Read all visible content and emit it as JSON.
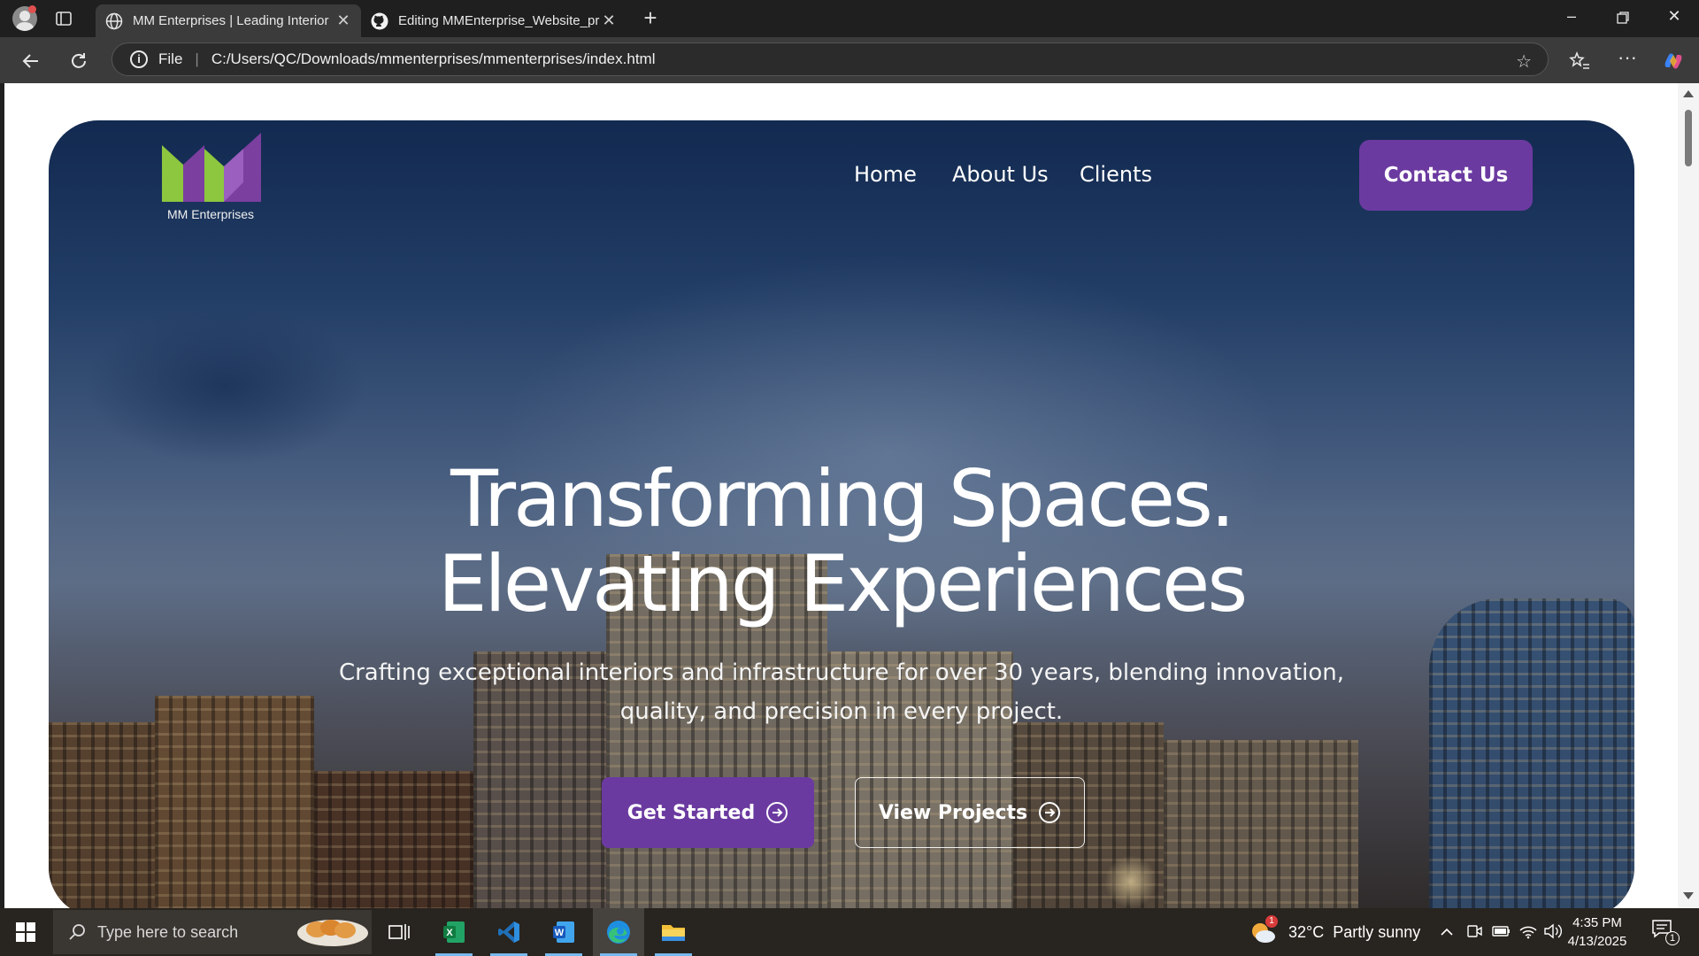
{
  "browser": {
    "tabs": [
      {
        "title": "MM Enterprises | Leading Interior",
        "active": true,
        "icon": "globe-icon"
      },
      {
        "title": "Editing MMEnterprise_Website_pr",
        "active": false,
        "icon": "github-icon"
      }
    ],
    "address": {
      "scheme_label": "File",
      "url": "C:/Users/QC/Downloads/mmenterprises/mmenterprises/index.html"
    }
  },
  "site": {
    "logo_text": "MM Enterprises",
    "nav": [
      {
        "label": "Home"
      },
      {
        "label": "About Us"
      },
      {
        "label": "Clients"
      }
    ],
    "contact_label": "Contact Us",
    "headline_line1": "Transforming Spaces.",
    "headline_line2": "Elevating Experiences",
    "subtitle": "Crafting exceptional interiors and infrastructure for over 30 years, blending innovation, quality, and precision in every project.",
    "primary_cta": "Get Started",
    "secondary_cta": "View Projects",
    "colors": {
      "accent": "#6b3aa0",
      "logo_green": "#8dc63f",
      "logo_purple": "#7b3fa0"
    }
  },
  "taskbar": {
    "search_placeholder": "Type here to search",
    "apps": [
      "task-view-icon",
      "excel-icon",
      "vscode-icon",
      "word-icon",
      "edge-icon",
      "file-explorer-icon"
    ],
    "weather_badge": "1",
    "weather": "32°C  Partly sunny",
    "time": "4:35 PM",
    "date": "4/13/2025",
    "notification_count": "1"
  }
}
